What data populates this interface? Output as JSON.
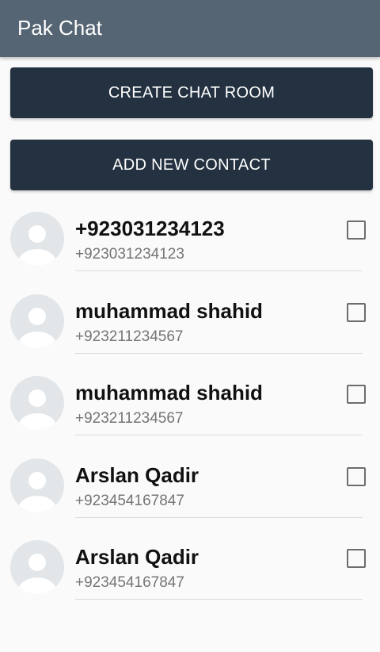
{
  "appbar": {
    "title": "Pak Chat"
  },
  "actions": {
    "create_chat_room": "CREATE CHAT ROOM",
    "add_new_contact": "ADD NEW CONTACT"
  },
  "contacts": [
    {
      "name": "+923031234123",
      "phone": "+923031234123",
      "checked": false,
      "avatar_icon": "person-placeholder-icon"
    },
    {
      "name": "muhammad shahid",
      "phone": "+923211234567",
      "checked": false,
      "avatar_icon": "person-placeholder-icon"
    },
    {
      "name": "muhammad shahid",
      "phone": "+923211234567",
      "checked": false,
      "avatar_icon": "person-placeholder-icon"
    },
    {
      "name": "Arslan Qadir",
      "phone": "+923454167847",
      "checked": false,
      "avatar_icon": "person-placeholder-icon"
    },
    {
      "name": "Arslan Qadir",
      "phone": "+923454167847",
      "checked": false,
      "avatar_icon": "person-placeholder-icon"
    }
  ],
  "colors": {
    "appbar": "#566573",
    "button": "#233140",
    "avatar_bg": "#e2e6e9",
    "avatar_fg": "#ffffff"
  }
}
